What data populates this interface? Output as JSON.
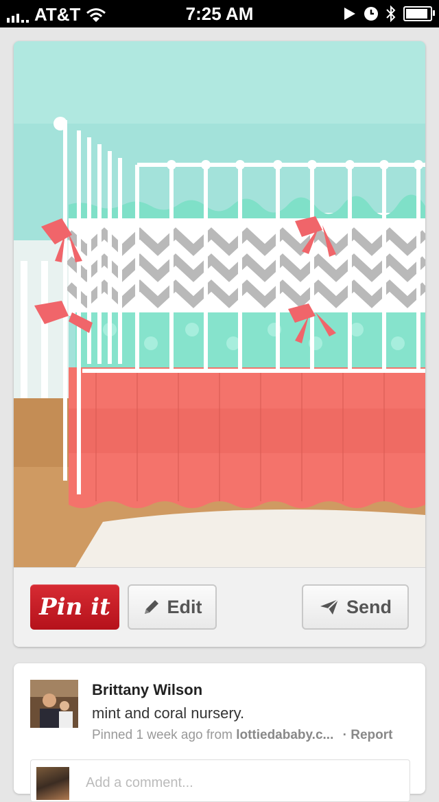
{
  "status_bar": {
    "carrier": "AT&T",
    "time": "7:25 AM",
    "battery_level": 0.9
  },
  "pin": {
    "image_alt": "crib with mint, grey chevron and coral ruffle bedding",
    "colors": {
      "wall": "#a3e2da",
      "mint": "#7fe0c8",
      "chevron_grey": "#b9b9b9",
      "coral": "#f4736b",
      "floor": "#c48d55",
      "rug": "#f3efe8"
    },
    "actions": {
      "pin_label": "Pin it",
      "edit_label": "Edit",
      "send_label": "Send"
    }
  },
  "pinner": {
    "name": "Brittany Wilson",
    "description": "mint and coral nursery.",
    "meta_prefix": "Pinned 1 week ago from ",
    "source": "lottiedababy.c...",
    "report_label": "· Report"
  },
  "comment": {
    "placeholder": "Add a comment..."
  }
}
